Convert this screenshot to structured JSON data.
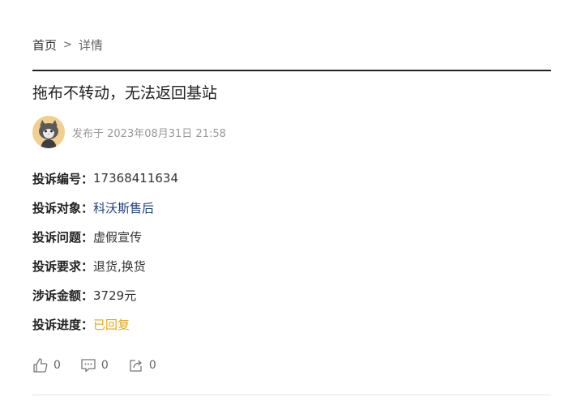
{
  "breadcrumb": {
    "home": "首页",
    "separator": ">",
    "current": "详情"
  },
  "complaint": {
    "title": "拖布不转动，无法返回基站",
    "publish_text": "发布于 2023年08月31日 21:58",
    "fields": {
      "id": {
        "label": "投诉编号：",
        "value": "17368411634"
      },
      "target": {
        "label": "投诉对象：",
        "value": "科沃斯售后"
      },
      "issue": {
        "label": "投诉问题：",
        "value": "虚假宣传"
      },
      "demand": {
        "label": "投诉要求：",
        "value": "退货,换货"
      },
      "amount": {
        "label": "涉诉金额：",
        "value": "3729元"
      },
      "progress": {
        "label": "投诉进度：",
        "value": "已回复"
      }
    }
  },
  "actions": {
    "like_count": "0",
    "comment_count": "0",
    "share_count": "0"
  },
  "colors": {
    "link": "#1e3f7c",
    "status": "#e6a817",
    "avatar_bg": "#f1cf8f"
  },
  "icons": {
    "like": "thumbs-up-icon",
    "comment": "comment-icon",
    "share": "share-icon",
    "avatar": "cat-avatar"
  }
}
